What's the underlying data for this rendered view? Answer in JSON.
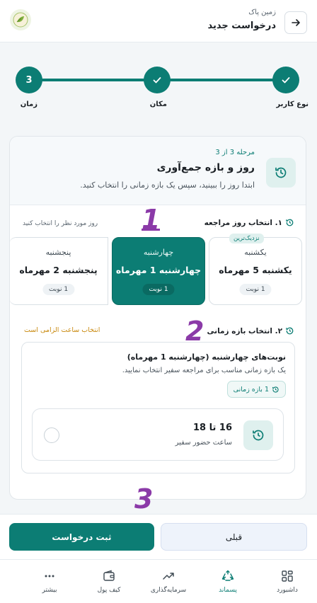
{
  "header": {
    "subtitle": "زمین پاک",
    "title": "درخواست جدید"
  },
  "stepper": {
    "steps": [
      {
        "label": "نوع کاربر",
        "state": "done"
      },
      {
        "label": "مکان",
        "state": "done"
      },
      {
        "label": "زمان",
        "state": "current",
        "number": "3"
      }
    ]
  },
  "card": {
    "step_of": "مرحله 3 از 3",
    "title": "روز و بازه جمع‌آوری",
    "description": "ابتدا روز را ببینید، سپس یک بازه زمانی را انتخاب کنید."
  },
  "day_section": {
    "title": "۱. انتخاب روز مراجعه",
    "hint": "روز مورد نظر را انتخاب کنید",
    "days": [
      {
        "name": "یکشنبه",
        "date": "یکشنبه 5 مهرماه",
        "badge": "1 نوبت",
        "tag": "نزدیک‌ترین",
        "selected": false
      },
      {
        "name": "چهارشنبه",
        "date": "چهارشنبه 1 مهرماه",
        "badge": "1 نوبت",
        "selected": true
      },
      {
        "name": "پنجشنبه",
        "date": "پنجشنبه 2 مهرماه",
        "badge": "1 نوبت",
        "selected": false
      }
    ]
  },
  "slot_section": {
    "title": "۲. انتخاب بازه زمانی",
    "required": "انتخاب ساعت الزامی است",
    "box_title": "نوبت‌های چهارشنبه (چهارشنبه 1 مهرماه)",
    "box_desc": "یک بازه زمانی مناسب برای مراجعه سفیر انتخاب نمایید.",
    "count": "1 بازه زمانی",
    "slots": [
      {
        "time": "16 تا 18",
        "sub": "ساعت حضور سفیر"
      }
    ]
  },
  "annotations": [
    "1",
    "2",
    "3"
  ],
  "actions": {
    "submit": "ثبت درخواست",
    "prev": "قبلی"
  },
  "nav": {
    "items": [
      {
        "label": "داشبورد",
        "icon": "grid-icon"
      },
      {
        "label": "پسماند",
        "icon": "recycle-icon",
        "active": true
      },
      {
        "label": "سرمایه‌گذاری",
        "icon": "trend-icon"
      },
      {
        "label": "کیف پول",
        "icon": "wallet-icon"
      },
      {
        "label": "بیشتر",
        "icon": "more-icon"
      }
    ]
  },
  "colors": {
    "primary": "#0c7d74",
    "annotation": "#8b3aa8",
    "warning": "#c98a10"
  }
}
